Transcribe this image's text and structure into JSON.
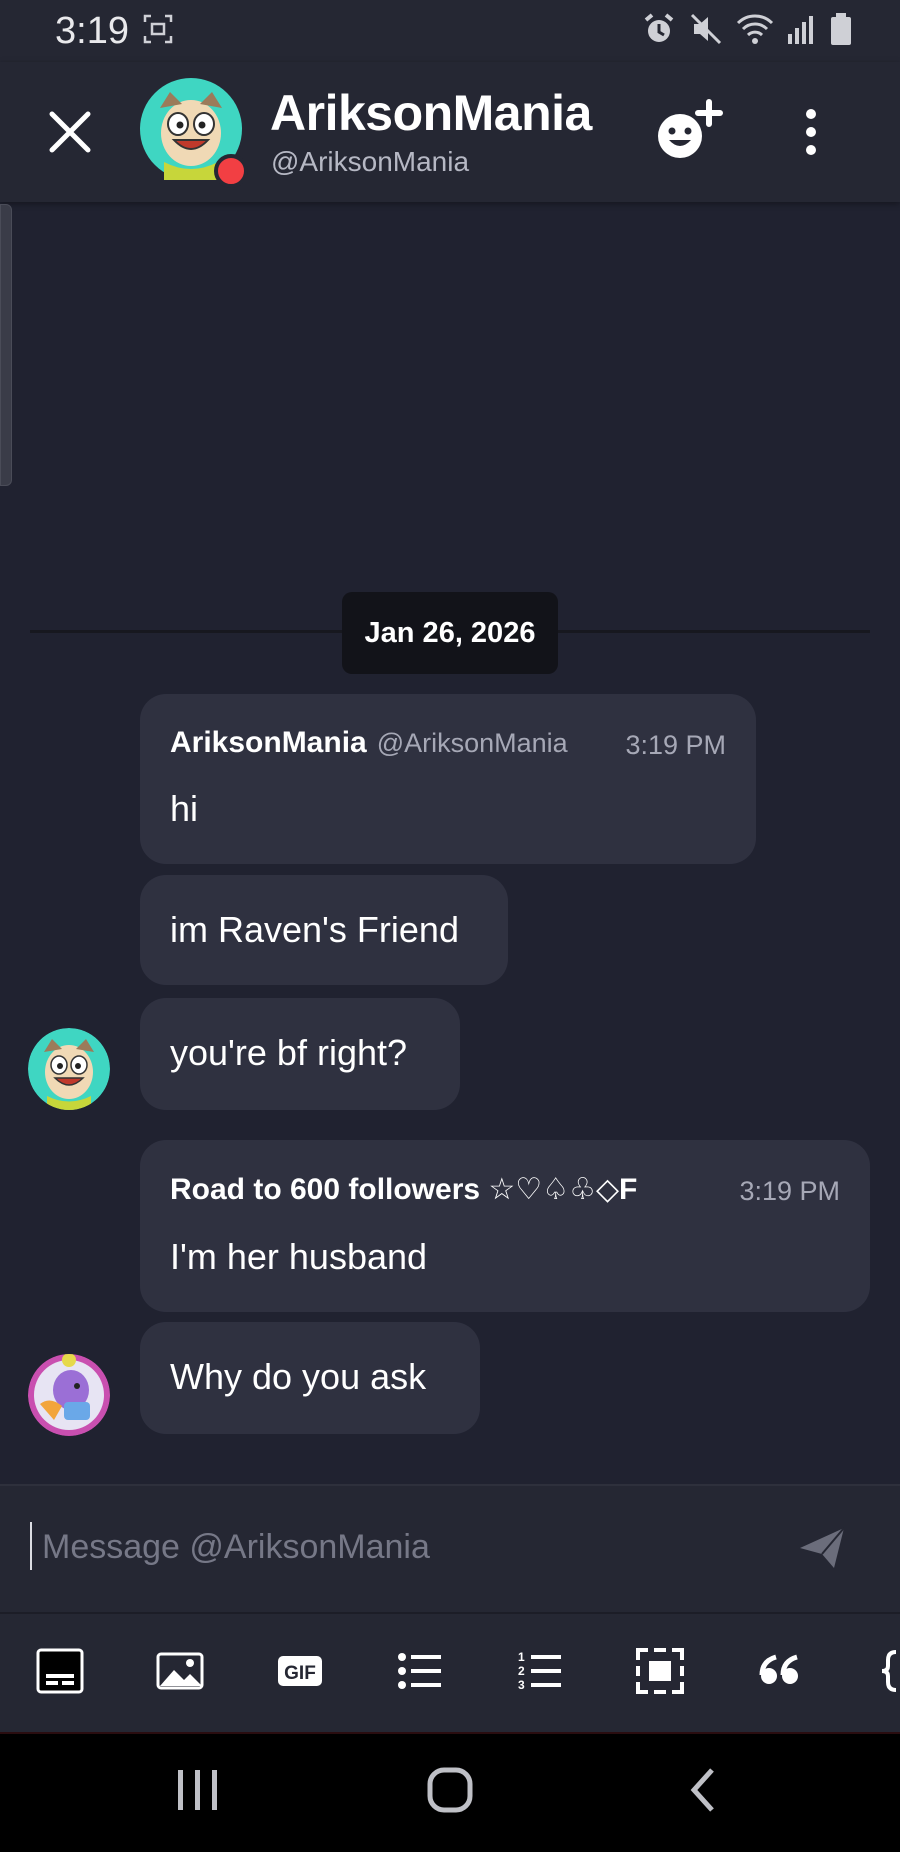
{
  "status_bar": {
    "time": "3:19"
  },
  "header": {
    "title": "AriksonMania",
    "subtitle": "@AriksonMania",
    "presence": "do-not-disturb",
    "colors": {
      "presence": "#f23f43"
    }
  },
  "date_divider": "Jan 26, 2026",
  "messages": [
    {
      "author": "AriksonMania",
      "handle": "@AriksonMania",
      "time": "3:19 PM",
      "text": "hi"
    },
    {
      "text": "im Raven's Friend"
    },
    {
      "text": "you're bf right?"
    },
    {
      "author": "Road to 600 followers ☆♡♤♧◇F",
      "handle": "",
      "time": "3:19 PM",
      "text": "I'm her husband"
    },
    {
      "text": "Why do you ask"
    }
  ],
  "composer": {
    "placeholder": "Message @AriksonMania"
  },
  "toolbar": {
    "items": [
      "subtitles-icon",
      "image-icon",
      "gif-icon",
      "bullet-list-icon",
      "numbered-list-icon",
      "spoiler-icon",
      "quote-icon",
      "code-block-icon"
    ]
  },
  "colors": {
    "background": "#202230",
    "bubble": "#2f3140",
    "header": "#252733"
  }
}
